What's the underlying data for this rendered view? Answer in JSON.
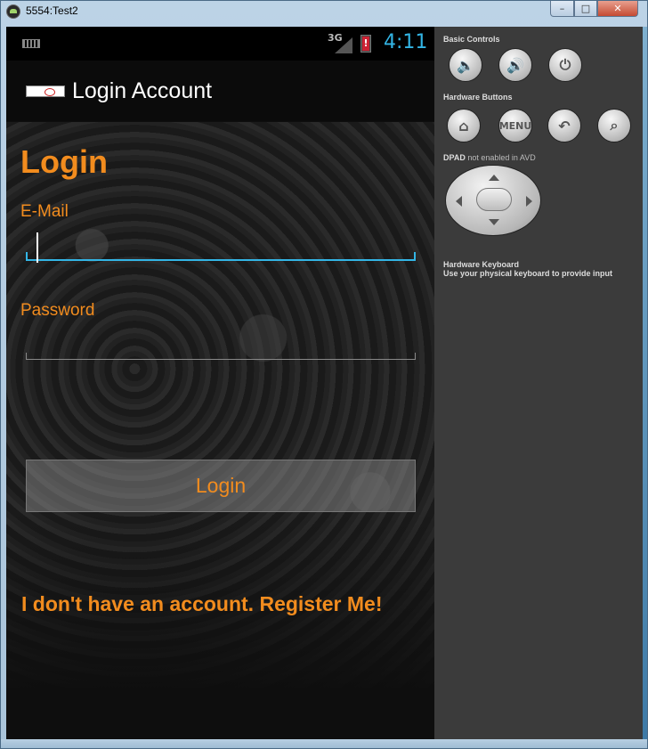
{
  "window": {
    "title": "5554:Test2",
    "minimize": "–",
    "maximize": "□",
    "close": "✕"
  },
  "statusbar": {
    "network": "3G",
    "time": "4:11"
  },
  "actionbar": {
    "title": "Login Account"
  },
  "form": {
    "heading": "Login",
    "email_label": "E-Mail",
    "email_value": "",
    "password_label": "Password",
    "password_value": "",
    "login_button": "Login",
    "register_link": "I don't have an account. Register Me!"
  },
  "panel": {
    "basic_controls": "Basic Controls",
    "hardware_buttons": "Hardware Buttons",
    "menu_label": "MENU",
    "dpad_title": "DPAD",
    "dpad_note": "not enabled in AVD",
    "keyboard_title": "Hardware Keyboard",
    "keyboard_note": "Use your physical keyboard to provide input"
  },
  "colors": {
    "accent": "#33b5e5",
    "text_orange": "#f28c1e"
  }
}
